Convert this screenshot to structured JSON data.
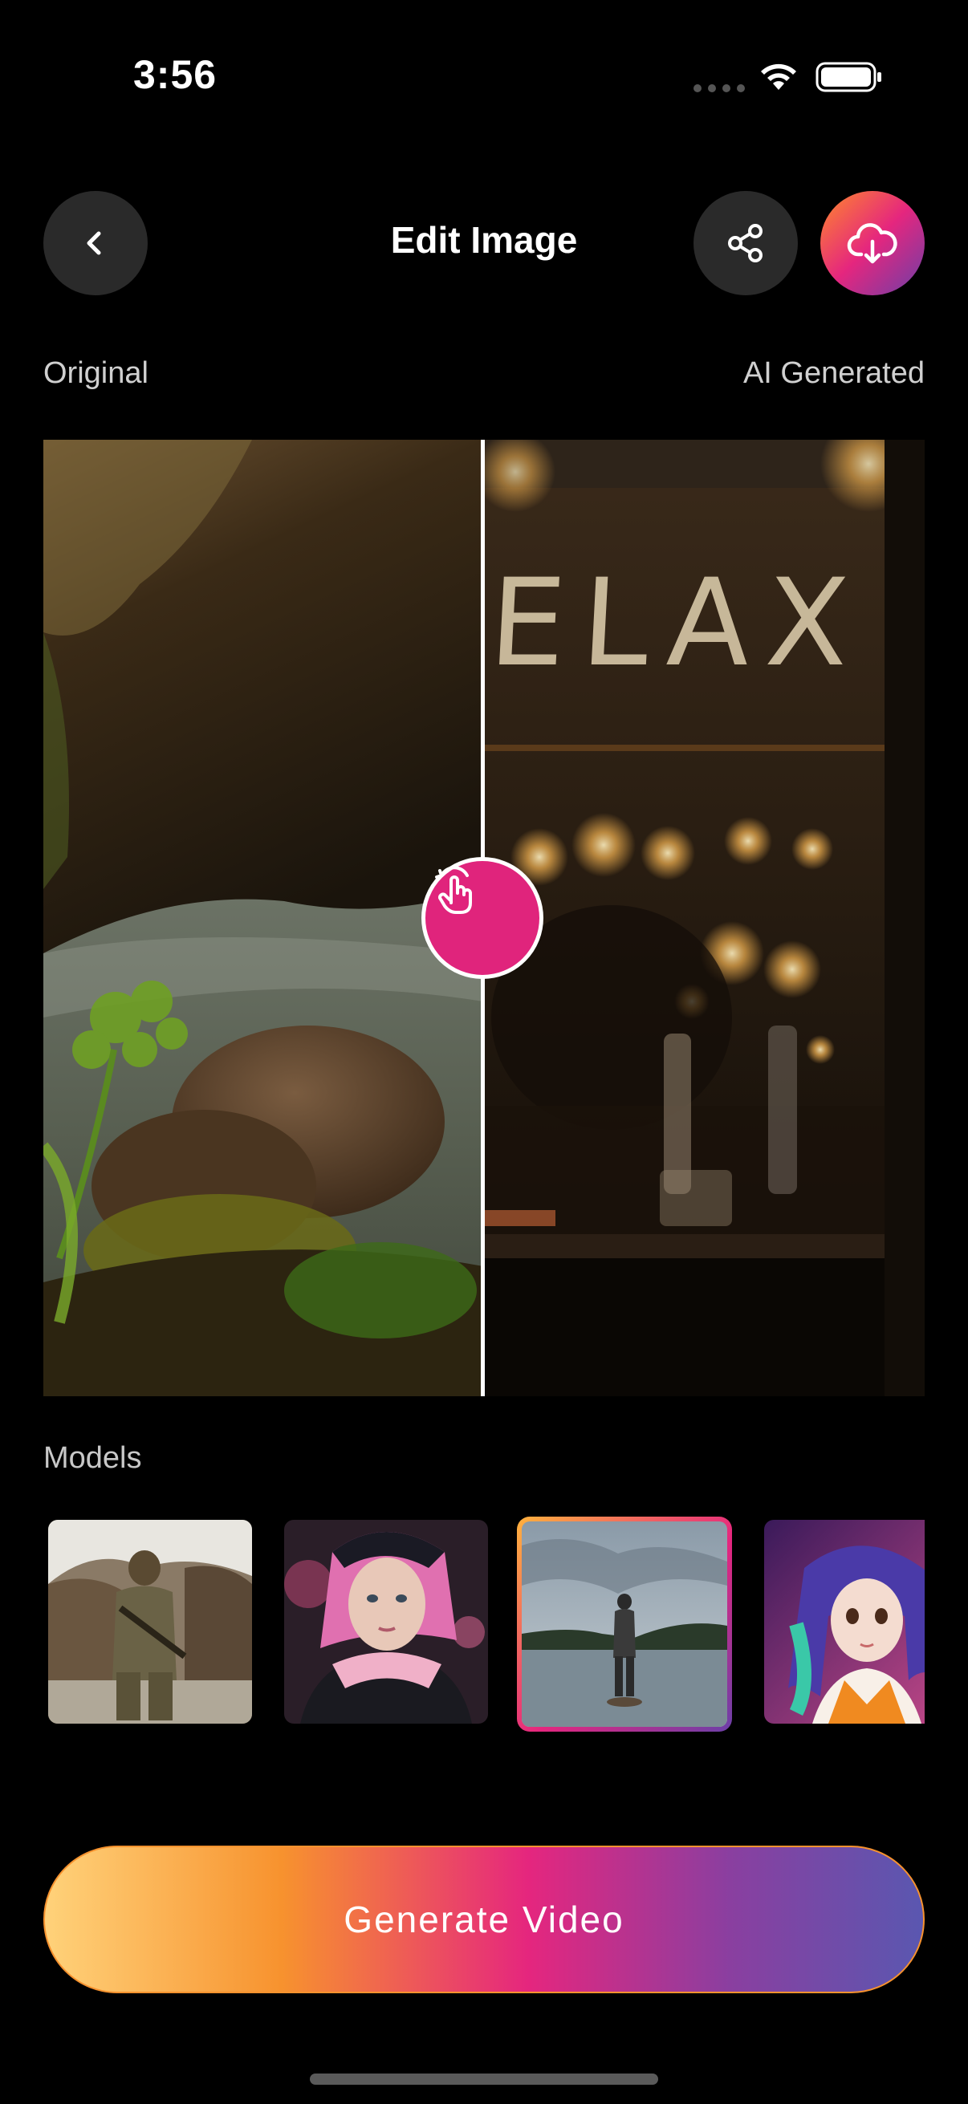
{
  "status_bar": {
    "time": "3:56",
    "icons": [
      "signal-icon",
      "wifi-icon",
      "battery-icon"
    ]
  },
  "header": {
    "title": "Edit Image",
    "back_icon": "chevron-left-icon",
    "share_icon": "share-icon",
    "download_icon": "cloud-download-icon"
  },
  "comparison": {
    "left_label": "Original",
    "right_label": "AI Generated",
    "divider_position": 0.5,
    "handle_icon": "swipe-hand-icon",
    "ai_image_sign_text": "ELAX"
  },
  "models": {
    "label": "Models",
    "items": [
      {
        "name": "soldier",
        "selected": false
      },
      {
        "name": "pink-hair-girl",
        "selected": false
      },
      {
        "name": "lake-figure",
        "selected": true
      },
      {
        "name": "anime-girl",
        "selected": false
      }
    ]
  },
  "generate": {
    "label": "Generate Video"
  },
  "colors": {
    "background": "#000000",
    "accent_pink": "#e0247c",
    "gradient_start": "#ffd27a",
    "gradient_orange": "#f7922e",
    "gradient_pink": "#e5267e",
    "gradient_purple": "#5a57b0",
    "button_dark": "#2a2a2a"
  }
}
